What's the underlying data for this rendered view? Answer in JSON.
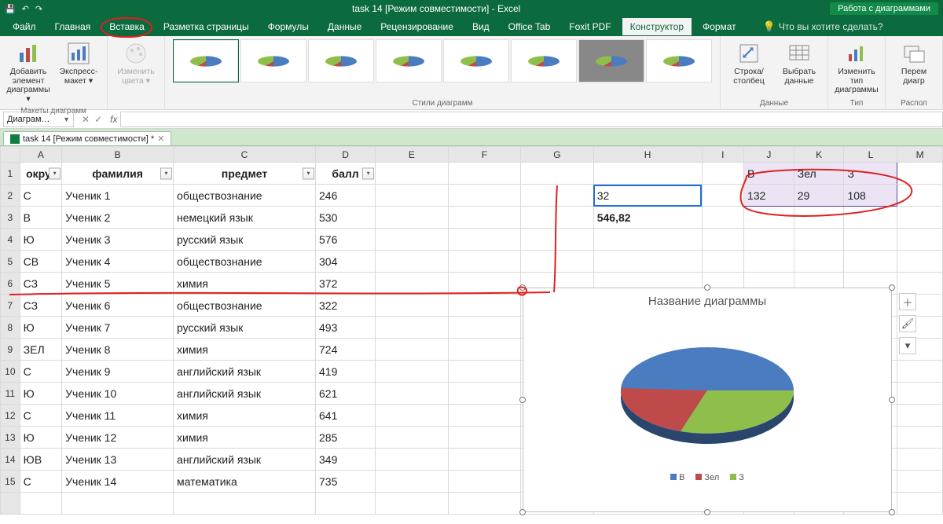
{
  "app": {
    "title": "task 14  [Режим совместимости] - Excel",
    "chart_tools_header": "Работа с диаграммами"
  },
  "ribbon_tabs": {
    "file": "Файл",
    "home": "Главная",
    "insert": "Вставка",
    "page_layout": "Разметка страницы",
    "formulas": "Формулы",
    "data": "Данные",
    "review": "Рецензирование",
    "view": "Вид",
    "office_tab": "Office Tab",
    "foxit": "Foxit PDF",
    "design": "Конструктор",
    "format": "Формат",
    "tell_me": "Что вы хотите сделать?"
  },
  "ribbon": {
    "add_element": "Добавить элемент диаграммы ▾",
    "quick_layout": "Экспресс-макет ▾",
    "change_colors": "Изменить цвета ▾",
    "styles_label": "Стили диаграмм",
    "layouts_label": "Макеты диаграмм",
    "row_col": "Строка/ столбец",
    "select_data": "Выбрать данные",
    "data_label": "Данные",
    "change_type": "Изменить тип диаграммы",
    "type_label": "Тип",
    "move_chart": "Перем диагр",
    "location_label": "Распол"
  },
  "name_box": "Диаграм…",
  "fx_label": "fx",
  "doc_tab": "task 14  [Режим совместимости] *",
  "headers": {
    "A": "округ",
    "B": "фамилия",
    "C": "предмет",
    "D": "балл"
  },
  "columns": [
    "A",
    "B",
    "C",
    "D",
    "E",
    "F",
    "G",
    "H",
    "I",
    "J",
    "K",
    "L",
    "M"
  ],
  "rows": [
    {
      "n": 2,
      "A": "С",
      "B": "Ученик 1",
      "C": "обществознание",
      "D": "246"
    },
    {
      "n": 3,
      "A": "В",
      "B": "Ученик 2",
      "C": "немецкий язык",
      "D": "530"
    },
    {
      "n": 4,
      "A": "Ю",
      "B": "Ученик 3",
      "C": "русский язык",
      "D": "576"
    },
    {
      "n": 5,
      "A": "СВ",
      "B": "Ученик 4",
      "C": "обществознание",
      "D": "304"
    },
    {
      "n": 6,
      "A": "СЗ",
      "B": "Ученик 5",
      "C": "химия",
      "D": "372"
    },
    {
      "n": 7,
      "A": "СЗ",
      "B": "Ученик 6",
      "C": "обществознание",
      "D": "322"
    },
    {
      "n": 8,
      "A": "Ю",
      "B": "Ученик 7",
      "C": "русский язык",
      "D": "493"
    },
    {
      "n": 9,
      "A": "ЗЕЛ",
      "B": "Ученик 8",
      "C": "химия",
      "D": "724"
    },
    {
      "n": 10,
      "A": "С",
      "B": "Ученик 9",
      "C": "английский язык",
      "D": "419"
    },
    {
      "n": 11,
      "A": "Ю",
      "B": "Ученик 10",
      "C": "английский язык",
      "D": "621"
    },
    {
      "n": 12,
      "A": "С",
      "B": "Ученик 11",
      "C": "химия",
      "D": "641"
    },
    {
      "n": 13,
      "A": "Ю",
      "B": "Ученик 12",
      "C": "химия",
      "D": "285"
    },
    {
      "n": 14,
      "A": "ЮВ",
      "B": "Ученик 13",
      "C": "английский язык",
      "D": "349"
    },
    {
      "n": 15,
      "A": "С",
      "B": "Ученик 14",
      "C": "математика",
      "D": "735"
    }
  ],
  "extra": {
    "H2": "32",
    "H3": "546,82",
    "J1": "В",
    "K1": "Зел",
    "L1": "З",
    "J2": "132",
    "K2": "29",
    "L2": "108"
  },
  "chart": {
    "title": "Название диаграммы",
    "legend": [
      "В",
      "Зел",
      "З"
    ]
  },
  "chart_data": {
    "type": "pie",
    "title": "Название диаграммы",
    "categories": [
      "В",
      "Зел",
      "З"
    ],
    "values": [
      132,
      29,
      108
    ],
    "colors": [
      "#4a7cbf",
      "#bf4a4a",
      "#8fbf4a"
    ],
    "three_d": true
  }
}
